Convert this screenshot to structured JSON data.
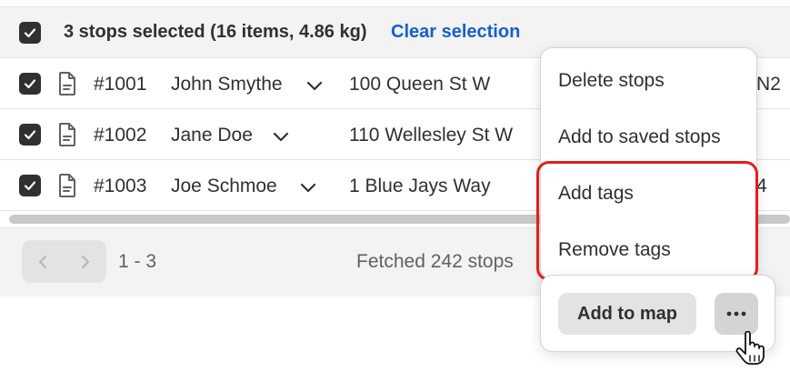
{
  "header": {
    "selection_summary": "3 stops selected (16 items, 4.86 kg)",
    "clear_label": "Clear selection"
  },
  "rows": [
    {
      "order": "#1001",
      "customer": "John Smythe",
      "address": "100 Queen St W",
      "trailing": "N2"
    },
    {
      "order": "#1002",
      "customer": "Jane Doe",
      "address": "110 Wellesley St W",
      "trailing": ""
    },
    {
      "order": "#1003",
      "customer": "Joe Schmoe",
      "address": "1 Blue Jays Way",
      "trailing": "4"
    }
  ],
  "footer": {
    "range": "1 - 3",
    "fetched": "Fetched 242 stops"
  },
  "menu": {
    "items": [
      "Delete stops",
      "Add to saved stops",
      "Add tags",
      "Remove tags"
    ]
  },
  "actions": {
    "add_to_map": "Add to map",
    "more_icon": "ellipsis-icon"
  },
  "colors": {
    "accent_link": "#1560cc",
    "highlight": "#e0201a",
    "checkbox": "#303030"
  }
}
